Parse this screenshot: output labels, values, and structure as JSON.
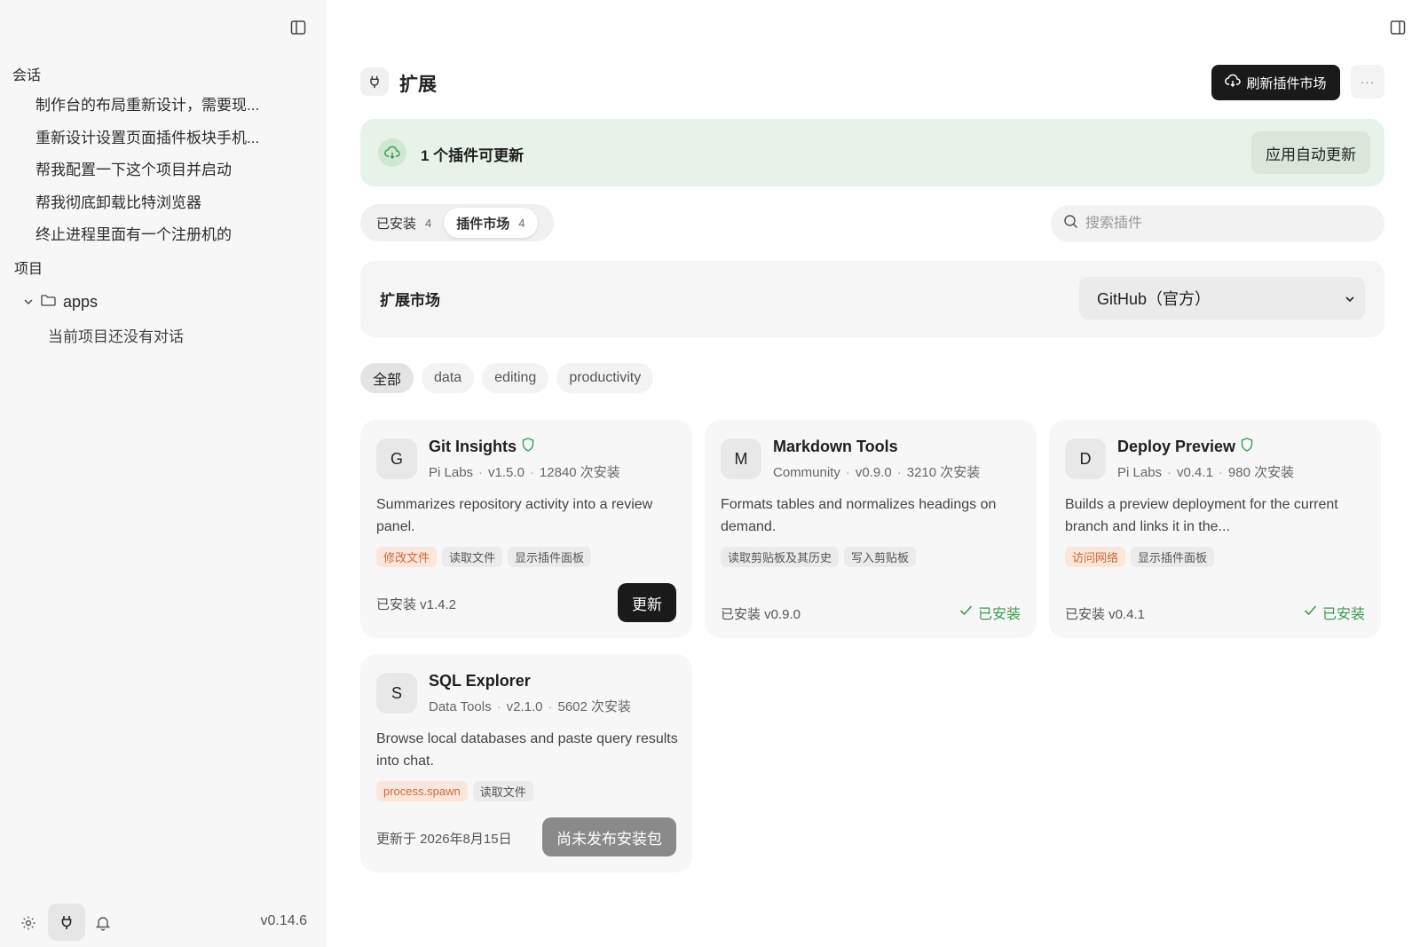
{
  "sidebar": {
    "conversations_label": "会话",
    "conversations": [
      "制作台的布局重新设计，需要现...",
      "重新设计设置页面插件板块手机...",
      "帮我配置一下这个项目并启动",
      "帮我彻底卸载比特浏览器",
      "终止进程里面有一个注册机的"
    ],
    "projects_label": "项目",
    "project_name": "apps",
    "project_empty": "当前项目还没有对话",
    "version": "v0.14.6"
  },
  "header": {
    "title": "扩展",
    "refresh_label": "刷新插件市场",
    "more_label": "···"
  },
  "banner": {
    "text": "1 个插件可更新",
    "button": "应用自动更新"
  },
  "tabs": [
    {
      "label": "已安装",
      "count": "4"
    },
    {
      "label": "插件市场",
      "count": "4"
    }
  ],
  "search": {
    "placeholder": "搜索插件"
  },
  "market": {
    "title": "扩展市场",
    "selected": "GitHub（官方）"
  },
  "filters": [
    "全部",
    "data",
    "editing",
    "productivity"
  ],
  "plugins": [
    {
      "initial": "G",
      "name": "Git Insights",
      "verified": true,
      "author": "Pi Labs",
      "version": "v1.5.0",
      "installs": "12840 次安装",
      "description": "Summarizes repository activity into a review panel.",
      "tags": [
        {
          "label": "修改文件",
          "warn": true
        },
        {
          "label": "读取文件",
          "warn": false
        },
        {
          "label": "显示插件面板",
          "warn": false
        }
      ],
      "installed_text": "已安装 v1.4.2",
      "action": "更新"
    },
    {
      "initial": "M",
      "name": "Markdown Tools",
      "verified": false,
      "author": "Community",
      "version": "v0.9.0",
      "installs": "3210 次安装",
      "description": "Formats tables and normalizes headings on demand.",
      "tags": [
        {
          "label": "读取剪贴板及其历史",
          "warn": false
        },
        {
          "label": "写入剪贴板",
          "warn": false
        }
      ],
      "installed_text": "已安装 v0.9.0",
      "action": "已安装"
    },
    {
      "initial": "D",
      "name": "Deploy Preview",
      "verified": true,
      "author": "Pi Labs",
      "version": "v0.4.1",
      "installs": "980 次安装",
      "description": "Builds a preview deployment for the current branch and links it in the...",
      "tags": [
        {
          "label": "访问网络",
          "warn": true
        },
        {
          "label": "显示插件面板",
          "warn": false
        }
      ],
      "installed_text": "已安装 v0.4.1",
      "action": "已安装"
    },
    {
      "initial": "S",
      "name": "SQL Explorer",
      "verified": false,
      "author": "Data Tools",
      "version": "v2.1.0",
      "installs": "5602 次安装",
      "description": "Browse local databases and paste query results into chat.",
      "tags": [
        {
          "label": "process.spawn",
          "warn": true
        },
        {
          "label": "读取文件",
          "warn": false
        }
      ],
      "installed_text": "更新于 2026年8月15日",
      "action": "尚未发布安装包"
    }
  ],
  "colors": {
    "accent_dark": "#1a1a1a",
    "banner_bg": "#e7f3e8",
    "installed_green": "#3f9a50",
    "warn_tag": "#d2663a"
  }
}
